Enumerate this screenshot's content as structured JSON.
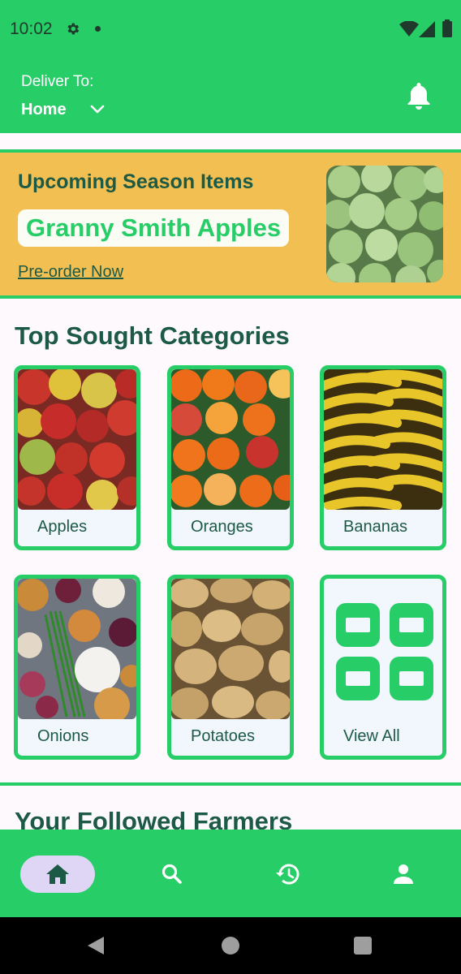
{
  "status_bar": {
    "time": "10:02"
  },
  "header": {
    "deliver_label": "Deliver To:",
    "deliver_value": "Home"
  },
  "banner": {
    "title": "Upcoming Season Items",
    "highlight": "Granny Smith Apples",
    "link": "Pre-order Now"
  },
  "categories": {
    "title": "Top Sought Categories",
    "items": [
      {
        "label": "Apples"
      },
      {
        "label": "Oranges"
      },
      {
        "label": "Bananas"
      },
      {
        "label": "Onions"
      },
      {
        "label": "Potatoes"
      },
      {
        "label": "View All"
      }
    ]
  },
  "farmers": {
    "title": "Your Followed Farmers"
  },
  "bottom_nav": {
    "items": [
      {
        "icon": "home-icon",
        "active": true
      },
      {
        "icon": "search-icon",
        "active": false
      },
      {
        "icon": "history-icon",
        "active": false
      },
      {
        "icon": "profile-icon",
        "active": false
      }
    ]
  },
  "colors": {
    "primary": "#27cd67",
    "banner": "#f1bf52",
    "text_dark": "#1d5a45",
    "nav_active": "#dfd6f6"
  }
}
